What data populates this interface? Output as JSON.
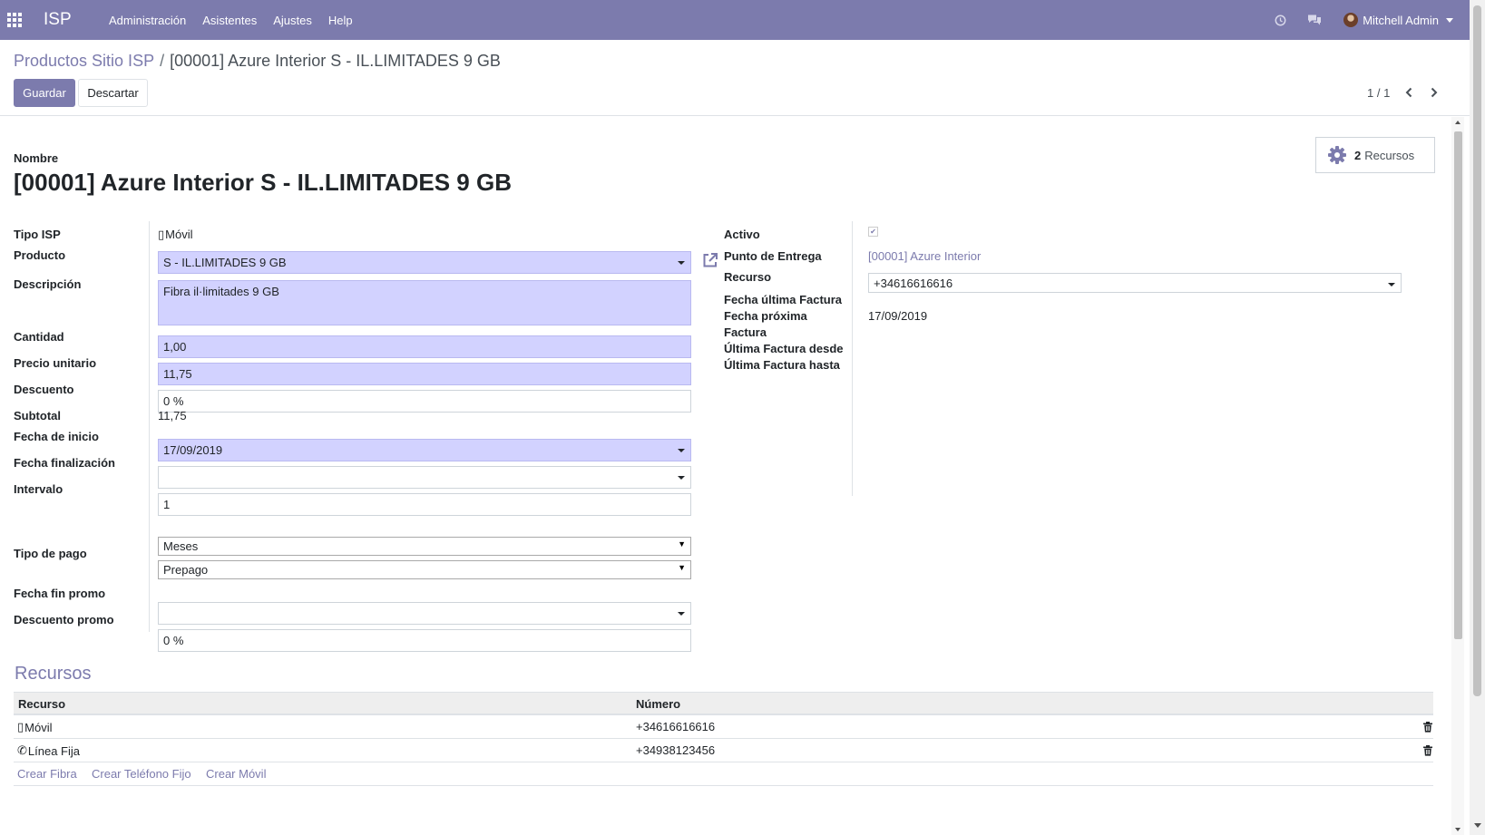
{
  "navbar": {
    "brand": "ISP",
    "menu": [
      "Administración",
      "Asistentes",
      "Ajustes",
      "Help"
    ],
    "user_name": "Mitchell Admin"
  },
  "breadcrumb": {
    "parent": "Productos Sitio ISP",
    "separator": "/",
    "current": "[00001] Azure Interior S - IL.LIMITADES 9 GB"
  },
  "actions": {
    "save_label": "Guardar",
    "discard_label": "Descartar"
  },
  "pager": {
    "value": "1 / 1"
  },
  "smart_button": {
    "count": "2",
    "label": "Recursos"
  },
  "form": {
    "name_label": "Nombre",
    "name_value": "[00001] Azure Interior S - IL.LIMITADES 9 GB",
    "left": {
      "tipo_isp_label": "Tipo ISP",
      "tipo_isp_value": "Móvil",
      "producto_label": "Producto",
      "producto_value": "S - IL.LIMITADES 9 GB",
      "descripcion_label": "Descripción",
      "descripcion_value": "Fibra il·limitades 9 GB",
      "cantidad_label": "Cantidad",
      "cantidad_value": "1,00",
      "precio_label": "Precio unitario",
      "precio_value": "11,75",
      "descuento_label": "Descuento",
      "descuento_value": "0 %",
      "subtotal_label": "Subtotal",
      "subtotal_value": "11,75",
      "fecha_inicio_label": "Fecha de inicio",
      "fecha_inicio_value": "17/09/2019",
      "fecha_fin_label": "Fecha finalización",
      "fecha_fin_value": "",
      "intervalo_label": "Intervalo",
      "intervalo_value": "1",
      "intervalo_unit_value": "Meses",
      "tipo_pago_label": "Tipo de pago",
      "tipo_pago_value": "Prepago",
      "fecha_fin_promo_label": "Fecha fin promo",
      "fecha_fin_promo_value": "",
      "descuento_promo_label": "Descuento promo",
      "descuento_promo_value": "0 %"
    },
    "right": {
      "activo_label": "Activo",
      "activo_checked": true,
      "punto_label": "Punto de Entrega",
      "punto_value": "[00001] Azure Interior",
      "recurso_label": "Recurso",
      "recurso_value": "+34616616616",
      "fecha_ultima_label": "Fecha última Factura",
      "fecha_proxima_label_1": "Fecha próxima",
      "fecha_proxima_label_2": "Factura",
      "fecha_proxima_value": "17/09/2019",
      "ultima_desde_label": "Última Factura desde",
      "ultima_hasta_label": "Última Factura hasta"
    }
  },
  "resources": {
    "title": "Recursos",
    "columns": [
      "Recurso",
      "Número"
    ],
    "rows": [
      {
        "icon": "mobile-icon",
        "recurso": "Móvil",
        "numero": "+34616616616"
      },
      {
        "icon": "phone-icon",
        "recurso": "Línea Fija",
        "numero": "+34938123456"
      }
    ],
    "add_links": [
      "Crear Fibra",
      "Crear Teléfono Fijo",
      "Crear Móvil"
    ]
  },
  "colors": {
    "brand": "#7c7bad",
    "required_field": "#d2d2ff"
  }
}
